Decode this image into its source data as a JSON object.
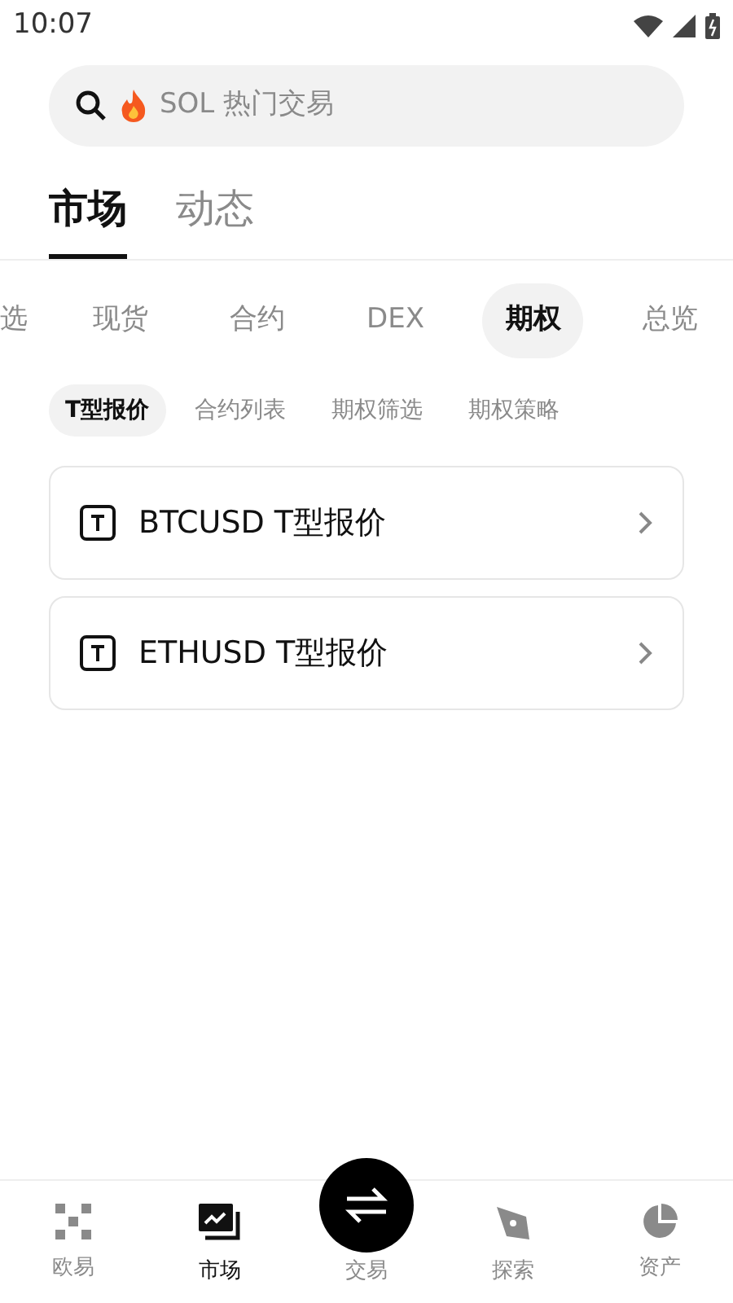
{
  "status_bar": {
    "time": "10:07"
  },
  "search": {
    "placeholder": "SOL 热门交易"
  },
  "main_tabs": [
    {
      "label": "市场",
      "selected": true
    },
    {
      "label": "动态",
      "selected": false
    }
  ],
  "categories": [
    {
      "label": "选",
      "selected": false
    },
    {
      "label": "现货",
      "selected": false
    },
    {
      "label": "合约",
      "selected": false
    },
    {
      "label": "DEX",
      "selected": false
    },
    {
      "label": "期权",
      "selected": true
    },
    {
      "label": "总览",
      "selected": false
    }
  ],
  "sub_tabs": [
    {
      "label": "T型报价",
      "selected": true
    },
    {
      "label": "合约列表",
      "selected": false
    },
    {
      "label": "期权筛选",
      "selected": false
    },
    {
      "label": "期权策略",
      "selected": false
    }
  ],
  "items": [
    {
      "label": "BTCUSD T型报价"
    },
    {
      "label": "ETHUSD T型报价"
    }
  ],
  "bottom_nav": [
    {
      "label": "欧易",
      "kind": "tab",
      "selected": false
    },
    {
      "label": "市场",
      "kind": "tab",
      "selected": true
    },
    {
      "label": "交易",
      "kind": "fab",
      "selected": false
    },
    {
      "label": "探索",
      "kind": "tab",
      "selected": false
    },
    {
      "label": "资产",
      "kind": "tab",
      "selected": false
    }
  ]
}
